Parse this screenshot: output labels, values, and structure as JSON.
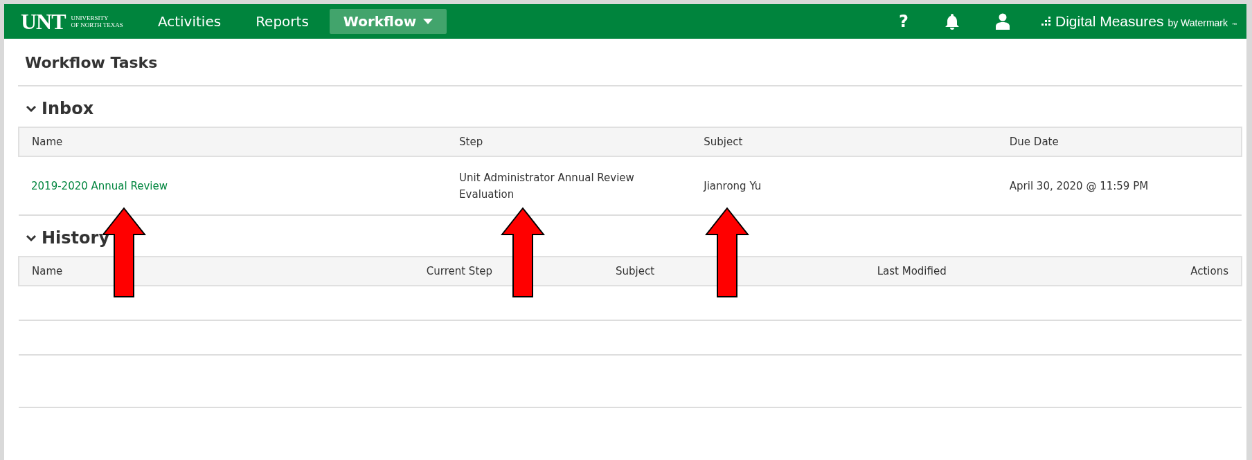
{
  "header": {
    "logo": {
      "mark": "UNT",
      "line1": "UNIVERSITY",
      "line2": "OF NORTH TEXAS"
    },
    "nav": [
      {
        "label": "Activities",
        "selected": false,
        "dropdown": false
      },
      {
        "label": "Reports",
        "selected": false,
        "dropdown": false
      },
      {
        "label": "Workflow",
        "selected": true,
        "dropdown": true
      }
    ],
    "help": "?",
    "brand": {
      "name": "Digital Measures",
      "by": "by Watermark",
      "tm": "™"
    }
  },
  "page_title": "Workflow Tasks",
  "inbox": {
    "title": "Inbox",
    "expanded": true,
    "columns": [
      "Name",
      "Step",
      "Subject",
      "Due Date"
    ],
    "rows": [
      {
        "name": "2019-2020 Annual Review",
        "step": "Unit Administrator Annual Review Evaluation",
        "subject": "Jianrong Yu",
        "due_date": "April 30, 2020 @ 11:59 PM"
      }
    ]
  },
  "history": {
    "title": "History",
    "expanded": true,
    "columns": [
      "Name",
      "Current Step",
      "Subject",
      "Last Modified",
      "Actions"
    ]
  }
}
